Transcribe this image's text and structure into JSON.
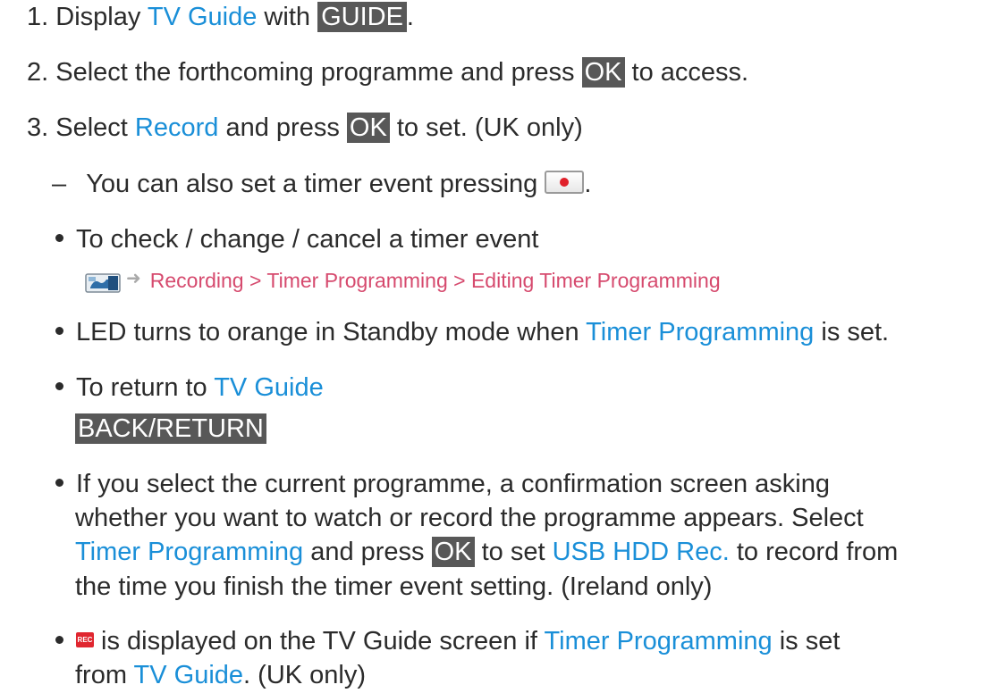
{
  "colors": {
    "link": "#1a8fd8",
    "key_background": "#585858",
    "breadcrumb": "#d64a6e"
  },
  "steps": [
    {
      "number": "1.",
      "before": "Display ",
      "link": "TV Guide",
      "middle": " with ",
      "key": "GUIDE",
      "after": "."
    },
    {
      "number": "2.",
      "before": "Select the forthcoming programme and press ",
      "key": "OK",
      "after": " to access."
    },
    {
      "number": "3.",
      "before": "Select ",
      "link": "Record",
      "middle": " and press ",
      "key": "OK",
      "after": " to set. (UK only)"
    }
  ],
  "dash_note": {
    "dash": "–",
    "text": "You can also set a timer event pressing ",
    "icon": "record-button-icon",
    "after": "."
  },
  "bullets": {
    "check_timer": {
      "text": "To check / change / cancel a timer event",
      "menu_icon": "menu-icon",
      "arrow_icon": "arrow-right-icon",
      "breadcrumb": "Recording > Timer Programming > Editing Timer Programming"
    },
    "led": {
      "before": "LED turns to orange in Standby mode when ",
      "link": "Timer Programming",
      "after": " is set."
    },
    "return": {
      "before": "To return to ",
      "link": "TV Guide",
      "key": "BACK/RETURN"
    },
    "current_programme": {
      "line1": "If you select the current programme, a confirmation screen asking",
      "line2": "whether you want to watch or record the programme appears. Select",
      "line3_link1": "Timer Programming",
      "line3_mid": " and press ",
      "line3_key": "OK",
      "line3_mid2": " to set ",
      "line3_link2": "USB HDD Rec.",
      "line3_after": " to record from",
      "line4": "the time you finish the timer event setting. (Ireland only)"
    },
    "rec_icon": {
      "icon_label": "REC",
      "icon": "rec-icon",
      "line1_before": " is displayed on the TV Guide screen if ",
      "line1_link": "Timer Programming",
      "line1_after": " is set",
      "line2_before": "from ",
      "line2_link": "TV Guide",
      "line2_after": ". (UK only)"
    }
  }
}
